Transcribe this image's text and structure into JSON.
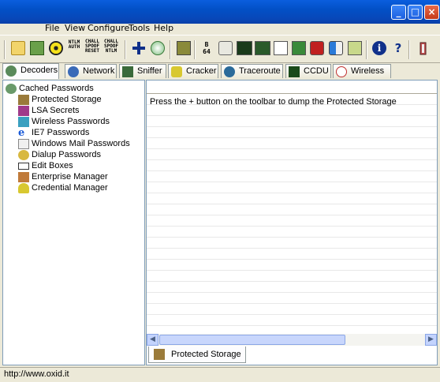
{
  "menu": {
    "items": [
      "File",
      "View",
      "Configure",
      "Tools",
      "Help"
    ]
  },
  "toolbar": {
    "ntlm_auth": [
      "NTLM",
      "AUTH"
    ],
    "chall_spoof_reset": [
      "CHALL",
      "SPOOF",
      "RESET"
    ],
    "chall_spoof_ntlm": [
      "CHALL",
      "SPOOF",
      "NTLM"
    ],
    "b64": [
      "B",
      "64"
    ]
  },
  "tabs": [
    {
      "label": "Decoders",
      "icon": "decoders-icon"
    },
    {
      "label": "Network",
      "icon": "network-icon"
    },
    {
      "label": "Sniffer",
      "icon": "sniffer-icon"
    },
    {
      "label": "Cracker",
      "icon": "cracker-icon"
    },
    {
      "label": "Traceroute",
      "icon": "traceroute-icon"
    },
    {
      "label": "CCDU",
      "icon": "ccdu-icon"
    },
    {
      "label": "Wireless",
      "icon": "wireless-icon"
    }
  ],
  "tree": {
    "root": "Cached Passwords",
    "children": [
      "Protected Storage",
      "LSA Secrets",
      "Wireless Passwords",
      "IE7 Passwords",
      "Windows Mail Passwords",
      "Dialup Passwords",
      "Edit Boxes",
      "Enterprise Manager",
      "Credential Manager"
    ]
  },
  "list": {
    "message": "Press the + button on the toolbar to dump the Protected Storage"
  },
  "bottom_tab": {
    "label": "Protected Storage"
  },
  "status": {
    "url": "http://www.oxid.it"
  },
  "colors": {
    "titlebar": "#0a5ede",
    "window_bg": "#ece9d8",
    "border": "#7f9db9"
  }
}
